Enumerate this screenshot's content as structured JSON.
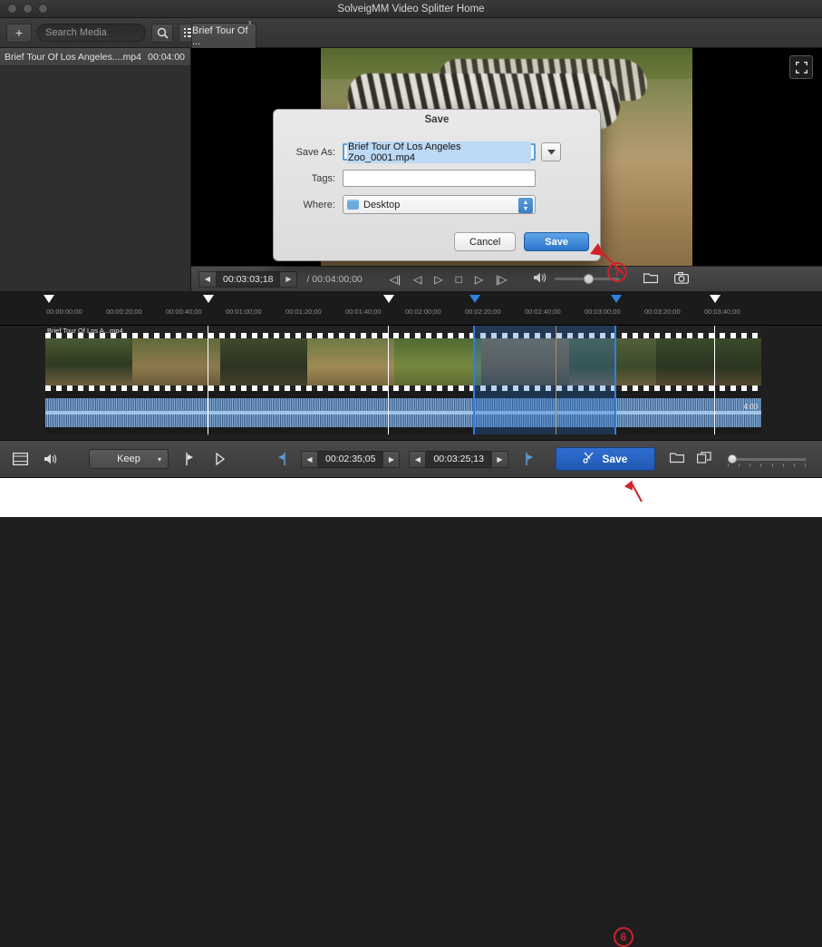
{
  "window": {
    "title": "SolveigMM Video Splitter Home"
  },
  "toolbar": {
    "add_label": "+",
    "search_placeholder": "Search Media",
    "search_icon": "search-icon",
    "list_icon": "list-view-icon",
    "grid_icon": "grid-view-icon",
    "tab_label": "Brief Tour Of ...",
    "tab_badge": "x"
  },
  "sidebar": {
    "media_item": {
      "name": "Brief Tour Of Los Angeles....mp4",
      "duration": "00:04:00"
    }
  },
  "player": {
    "current_time": "00:03:03;18",
    "total_time": "/ 00:04:00;00",
    "fullscreen_icon": "fullscreen-icon",
    "transport": [
      {
        "name": "prev-frame-group-icon",
        "glyph": "◁|"
      },
      {
        "name": "step-back-icon",
        "glyph": "◁"
      },
      {
        "name": "play-icon",
        "glyph": "▷"
      },
      {
        "name": "stop-icon",
        "glyph": "□"
      },
      {
        "name": "step-forward-icon",
        "glyph": "▷"
      },
      {
        "name": "next-frame-group-icon",
        "glyph": "|▷"
      }
    ],
    "speaker_icon": "speaker-icon",
    "folder_icon": "open-folder-icon",
    "snapshot_icon": "camera-snapshot-icon"
  },
  "timeline": {
    "clip_label": "Brief Tour Of Los A...mp4",
    "clip_end_label": "4:00",
    "ruler_labels": [
      "00:00:00;00",
      "00:00:20;00",
      "00:00:40;00",
      "00:01:00;00",
      "00:01:20;00",
      "00:01:40;00",
      "00:02:00;00",
      "00:02:20;00",
      "00:02:40;00",
      "00:03:00;00",
      "00:03:20;00",
      "00:03:40;00"
    ]
  },
  "bottombar": {
    "timeline_icon": "timeline-view-icon",
    "mute_icon": "speaker-icon",
    "mode_label": "Keep",
    "mode_caret": "▾",
    "marker_in_icon": "set-marker-icon",
    "marker_play_icon": "play-fragment-icon",
    "add_marker_icon": "add-marker-icon",
    "start_time": "00:02:35;05",
    "end_time": "00:03:25;13",
    "prev_glyph": "◀",
    "next_glyph": "▶",
    "save_label": "Save",
    "save_icon": "scissors-save-icon",
    "open_folder_icon": "open-folder-icon",
    "export_icon": "export-icon"
  },
  "dialog": {
    "title": "Save",
    "fields": {
      "save_as_label": "Save As:",
      "save_as_value": "Brief Tour Of Los Angeles Zoo_0001.mp4",
      "tags_label": "Tags:",
      "tags_value": "",
      "where_label": "Where:",
      "where_value": "Desktop",
      "disclosure_icon": "chevron-down-icon"
    },
    "cancel_label": "Cancel",
    "save_label": "Save"
  },
  "callouts": {
    "step6": "6",
    "step7": "7",
    "accent": "#d0222a"
  }
}
